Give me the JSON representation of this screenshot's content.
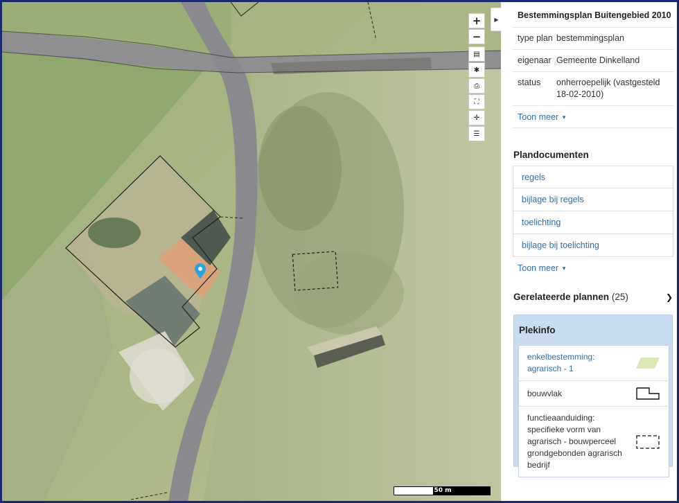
{
  "map": {
    "tools": [
      {
        "name": "zoom-in-button",
        "icon": "plus-icon",
        "glyph": "+"
      },
      {
        "name": "zoom-out-button",
        "icon": "minus-icon",
        "glyph": "−"
      },
      {
        "name": "layers-button",
        "icon": "layers-icon",
        "glyph": "▤"
      },
      {
        "name": "settings-button",
        "icon": "gear-icon",
        "glyph": "✱"
      },
      {
        "name": "print-button",
        "icon": "print-icon",
        "glyph": "⎙"
      },
      {
        "name": "fullscreen-button",
        "icon": "fullscreen-icon",
        "glyph": "⛶"
      },
      {
        "name": "locate-button",
        "icon": "crosshair-icon",
        "glyph": "✛"
      },
      {
        "name": "legend-button",
        "icon": "list-icon",
        "glyph": "☰"
      }
    ],
    "scalebar_label": "50 m",
    "marker_color": "#2aa3d8",
    "collapse_icon": "caret-right-icon"
  },
  "plan": {
    "title": "Bestemmingsplan Buitengebied 2010",
    "properties": [
      {
        "key": "type plan",
        "value": "bestemmingsplan"
      },
      {
        "key": "eigenaar",
        "value": "Gemeente Dinkelland"
      },
      {
        "key": "status",
        "value": "onherroepelijk (vastgesteld 18-02-2010)"
      }
    ],
    "show_more": "Toon meer"
  },
  "documents": {
    "title": "Plandocumenten",
    "items": [
      "regels",
      "bijlage bij regels",
      "toelichting",
      "bijlage bij toelichting"
    ],
    "show_more": "Toon meer"
  },
  "related": {
    "title": "Gerelateerde plannen",
    "count": "(25)",
    "icon": "chevron-down-icon"
  },
  "plekinfo": {
    "title": "Plekinfo",
    "rows": [
      {
        "text": "enkelbestemming: agrarisch - 1",
        "link": true,
        "legend": "green-parallelogram"
      },
      {
        "text": "bouwvlak",
        "link": false,
        "legend": "outline-stepped"
      },
      {
        "text": "functieaanduiding: specifieke vorm van agrarisch - bouwperceel grondgebonden agrarisch bedrijf",
        "link": false,
        "legend": "dashed-rectangle"
      }
    ]
  },
  "colors": {
    "accent_link": "#2f6fa6",
    "frame": "#1b2a6e",
    "plekinfo_bg": "#c9dbef",
    "legend_green": "#d9e8b6"
  }
}
